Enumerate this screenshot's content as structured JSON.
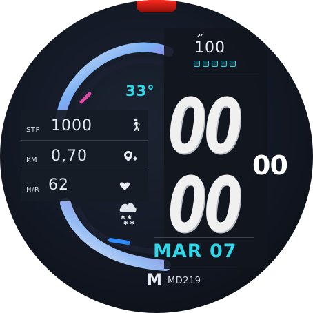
{
  "battery": {
    "value": "100",
    "icon": "lightning-icon"
  },
  "weather": {
    "temperature": "33°",
    "icon": "snow-cloud-icon"
  },
  "stats": [
    {
      "label": "STP",
      "value": "1000",
      "icon": "walking-icon"
    },
    {
      "label": "KM",
      "value": "0,70",
      "icon": "location-pin-icon"
    },
    {
      "label": "H/R",
      "value": "62",
      "icon": "heart-icon"
    }
  ],
  "time": {
    "hours": "00",
    "minutes": "00",
    "seconds": "00"
  },
  "date": "MAR 07",
  "brand": {
    "logo": "M",
    "model": "MD219"
  },
  "colors": {
    "accent": "#2fd6e8",
    "heart_bar": "#e24ca8",
    "blue_bar": "#2f8cff",
    "crown": "#d0201a"
  }
}
